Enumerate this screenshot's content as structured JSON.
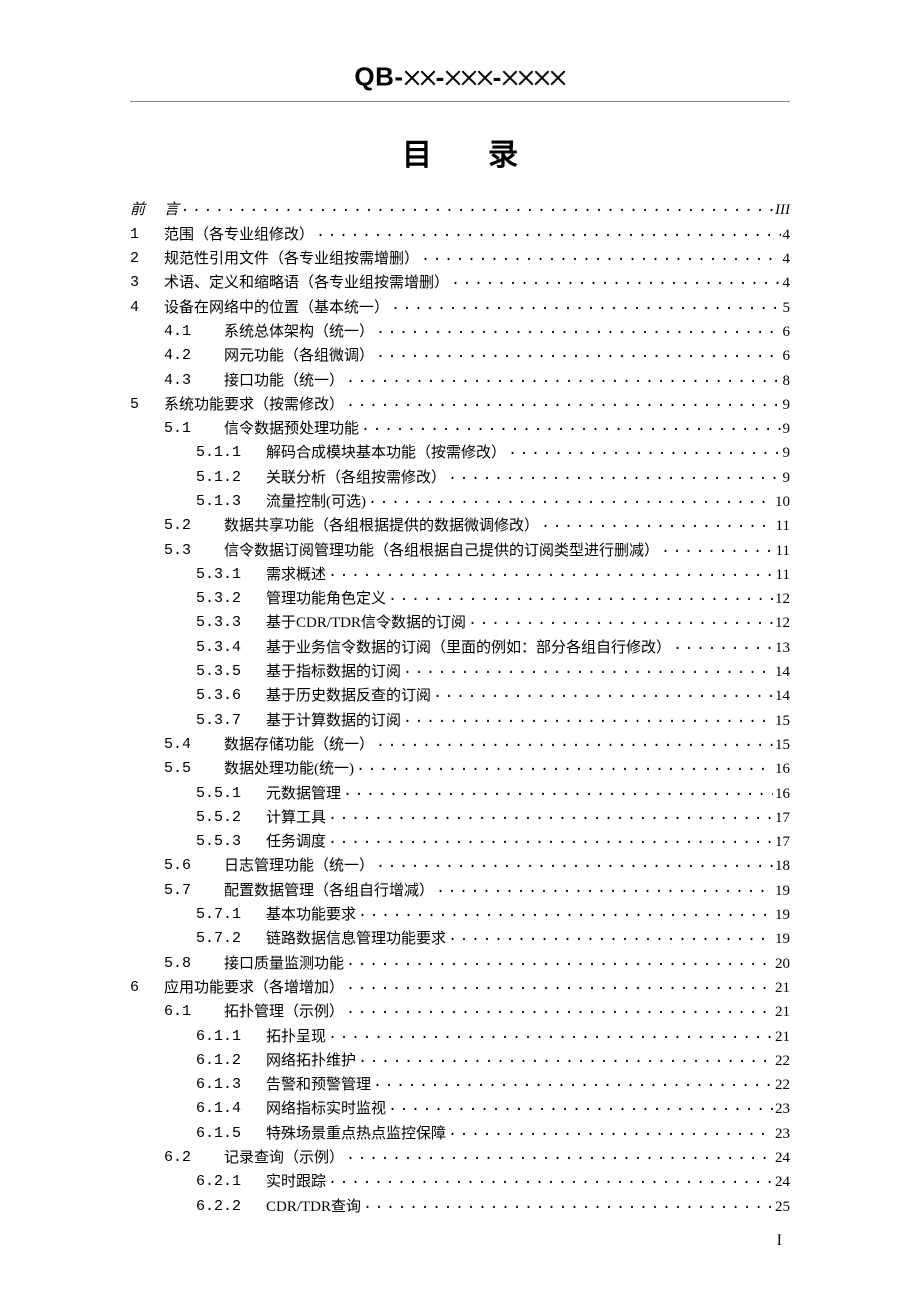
{
  "header_prefix": "QB-",
  "title_a": "目",
  "title_b": "录",
  "page_number": "I",
  "toc": [
    {
      "lvl": "0",
      "num": "",
      "pre": "前",
      "txt": "言",
      "pg": "III"
    },
    {
      "lvl": "1",
      "num": "1",
      "txt": "范围（各专业组修改）",
      "pg": "4"
    },
    {
      "lvl": "1",
      "num": "2",
      "txt": "规范性引用文件（各专业组按需增删）",
      "pg": "4"
    },
    {
      "lvl": "1",
      "num": "3",
      "txt": "术语、定义和缩略语（各专业组按需增删）",
      "pg": "4"
    },
    {
      "lvl": "1",
      "num": "4",
      "txt": "设备在网络中的位置（基本统一）",
      "pg": "5"
    },
    {
      "lvl": "2",
      "num": "4.1",
      "txt": "系统总体架构（统一）",
      "pg": "6"
    },
    {
      "lvl": "2",
      "num": "4.2",
      "txt": "网元功能（各组微调）",
      "pg": "6"
    },
    {
      "lvl": "2",
      "num": "4.3",
      "txt": "接口功能（统一）",
      "pg": "8"
    },
    {
      "lvl": "1",
      "num": "5",
      "txt": "系统功能要求（按需修改）",
      "pg": "9"
    },
    {
      "lvl": "2",
      "num": "5.1",
      "txt": "信令数据预处理功能",
      "pg": "9"
    },
    {
      "lvl": "3",
      "num": "5.1.1",
      "txt": "解码合成模块基本功能（按需修改）",
      "pg": "9"
    },
    {
      "lvl": "3",
      "num": "5.1.2",
      "txt": "关联分析（各组按需修改）",
      "pg": "9"
    },
    {
      "lvl": "3",
      "num": "5.1.3",
      "txt": "流量控制(可选)",
      "pg": "10"
    },
    {
      "lvl": "2",
      "num": "5.2",
      "txt": "数据共享功能（各组根据提供的数据微调修改）",
      "pg": "11"
    },
    {
      "lvl": "2",
      "num": "5.3",
      "txt": "信令数据订阅管理功能（各组根据自己提供的订阅类型进行删减）",
      "pg": "11"
    },
    {
      "lvl": "3",
      "num": "5.3.1",
      "txt": "需求概述",
      "pg": "11"
    },
    {
      "lvl": "3",
      "num": "5.3.2",
      "txt": "管理功能角色定义",
      "pg": "12"
    },
    {
      "lvl": "3",
      "num": "5.3.3",
      "txt": "基于CDR/TDR信令数据的订阅",
      "pg": "12"
    },
    {
      "lvl": "3",
      "num": "5.3.4",
      "txt": "基于业务信令数据的订阅（里面的例如：部分各组自行修改）",
      "pg": "13"
    },
    {
      "lvl": "3",
      "num": "5.3.5",
      "txt": "基于指标数据的订阅",
      "pg": "14"
    },
    {
      "lvl": "3",
      "num": "5.3.6",
      "txt": "基于历史数据反查的订阅",
      "pg": "14"
    },
    {
      "lvl": "3",
      "num": "5.3.7",
      "txt": "基于计算数据的订阅",
      "pg": "15"
    },
    {
      "lvl": "2",
      "num": "5.4",
      "txt": "数据存储功能（统一）",
      "pg": "15"
    },
    {
      "lvl": "2",
      "num": "5.5",
      "txt": "数据处理功能(统一)",
      "pg": "16"
    },
    {
      "lvl": "3",
      "num": "5.5.1",
      "txt": "元数据管理",
      "pg": "16"
    },
    {
      "lvl": "3",
      "num": "5.5.2",
      "txt": "计算工具",
      "pg": "17"
    },
    {
      "lvl": "3",
      "num": "5.5.3",
      "txt": "任务调度",
      "pg": "17"
    },
    {
      "lvl": "2",
      "num": "5.6",
      "txt": "日志管理功能（统一）",
      "pg": "18"
    },
    {
      "lvl": "2",
      "num": "5.7",
      "txt": "配置数据管理（各组自行增减）",
      "pg": "19"
    },
    {
      "lvl": "3",
      "num": "5.7.1",
      "txt": "基本功能要求",
      "pg": "19"
    },
    {
      "lvl": "3",
      "num": "5.7.2",
      "txt": "链路数据信息管理功能要求",
      "pg": "19"
    },
    {
      "lvl": "2",
      "num": "5.8",
      "txt": "接口质量监测功能",
      "pg": "20"
    },
    {
      "lvl": "1",
      "num": "6",
      "txt": "应用功能要求（各增增加）",
      "pg": "21"
    },
    {
      "lvl": "2",
      "num": "6.1",
      "txt": "拓扑管理（示例）",
      "pg": "21"
    },
    {
      "lvl": "3",
      "num": "6.1.1",
      "txt": "拓扑呈现",
      "pg": "21"
    },
    {
      "lvl": "3",
      "num": "6.1.2",
      "txt": "网络拓扑维护",
      "pg": "22"
    },
    {
      "lvl": "3",
      "num": "6.1.3",
      "txt": "告警和预警管理",
      "pg": "22"
    },
    {
      "lvl": "3",
      "num": "6.1.4",
      "txt": "网络指标实时监视",
      "pg": "23"
    },
    {
      "lvl": "3",
      "num": "6.1.5",
      "txt": "特殊场景重点热点监控保障",
      "pg": "23"
    },
    {
      "lvl": "2",
      "num": "6.2",
      "txt": "记录查询（示例）",
      "pg": "24"
    },
    {
      "lvl": "3",
      "num": "6.2.1",
      "txt": "实时跟踪",
      "pg": "24"
    },
    {
      "lvl": "3",
      "num": "6.2.2",
      "txt": "CDR/TDR查询",
      "pg": "25"
    }
  ]
}
